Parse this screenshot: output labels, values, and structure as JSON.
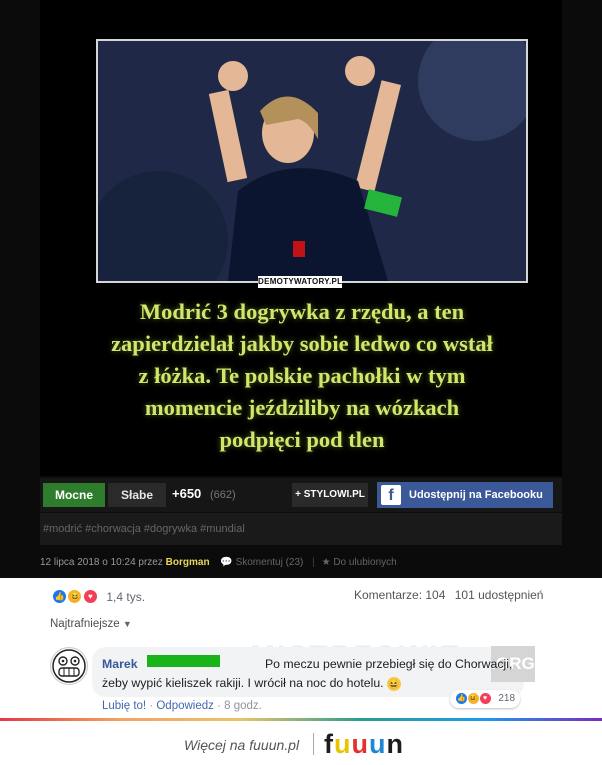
{
  "demotivator": {
    "watermark": "DEMOTYWATORY.PL",
    "caption_lines": [
      "Modrić 3 dogrywka z rzędu, a ten",
      "zapierdzielał jakby sobie ledwo co wstał",
      "z łóżka. Te polskie pachołki w tym",
      "momencie jeździliby na wózkach",
      "podpięci pod tlen"
    ]
  },
  "actions": {
    "mocne": "Mocne",
    "slabe": "Słabe",
    "score": "+650",
    "score_sub": "(662)",
    "stylowi": "+ STYLOWI.PL",
    "facebook": "Udostępnij na Facebooku"
  },
  "tags": "#modrić #chorwacja #dogrywka #mundial",
  "meta": {
    "date": "12 lipca 2018 o 10:24 przez",
    "author": "Borgman",
    "comment": "Skomentuj (23)",
    "fav": "Do ulubionych"
  },
  "fb": {
    "reactions_count": "1,4 tys.",
    "comments": "Komentarze: 104",
    "shares": "101 udostępnień",
    "sort": "Najtrafniejsze",
    "comment_author": "Marek",
    "comment_text_1": "Po meczu pewnie przebiegł się do Chorwacji,",
    "comment_text_2": "żeby wypić kieliszek rakiji. I wrócił na noc do hotelu.",
    "comment_reactions": "218",
    "like": "Lubię to!",
    "reply": "Odpowiedz",
    "time": "8 godz.",
    "watermark": "MISTRZOWIE",
    "org": ".ORG"
  },
  "footer": {
    "more": "Więcej na fuuun.pl",
    "logo_letters": [
      "f",
      "u",
      "u",
      "u",
      "n"
    ],
    "logo_colors": [
      "#1d1d1b",
      "#e9c400",
      "#e6312b",
      "#1e88d6",
      "#1d1d1b"
    ]
  }
}
